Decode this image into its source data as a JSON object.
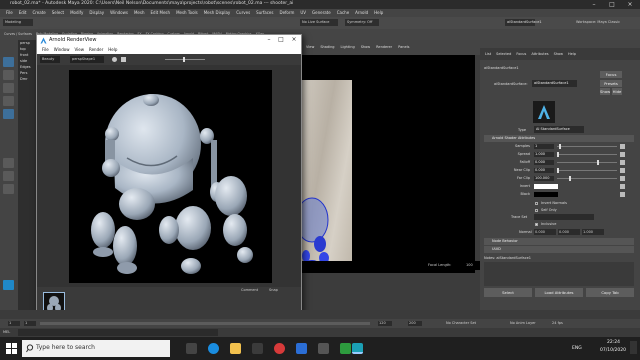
{
  "maya": {
    "title": "robot_02.ma* - Autodesk Maya 2020: C:\\Users\\Neil Nelson\\Documents\\maya\\projects\\robot\\scenes\\robot_02.ma --- shooter_ai",
    "workspace_label": "Workspace: Maya Classic",
    "menus": [
      "File",
      "Edit",
      "Create",
      "Select",
      "Modify",
      "Display",
      "Windows",
      "Mesh",
      "Edit Mesh",
      "Mesh Tools",
      "Mesh Display",
      "Curves",
      "Surfaces",
      "Deform",
      "UV",
      "Generate",
      "Cache",
      "Arnold",
      "Help"
    ],
    "mode_menu": "Modeling",
    "live_surface": "No Live Surface",
    "symmetry": "Symmetry: Off",
    "shelf_tabs": [
      "Curves / Surfaces",
      "Poly Modeling",
      "Sculpting",
      "Rigging",
      "Animation",
      "Rendering",
      "FX",
      "FX Caching",
      "Custom",
      "Arnold",
      "Bifrost",
      "MASH",
      "Motion Graphics",
      "XGen"
    ],
    "outliner_items": [
      "persp",
      "top",
      "front",
      "side",
      "Edges",
      "Pers",
      "Dmr"
    ],
    "viewport": {
      "menus": [
        "View",
        "Shading",
        "Lighting",
        "Show",
        "Renderer",
        "Panels"
      ],
      "focal_length_label": "Focal Length:",
      "focal_length_value": "100"
    },
    "attribute_editor": {
      "tabs": [
        "List",
        "Selected",
        "Focus",
        "Attributes",
        "Show",
        "Help"
      ],
      "node_tab": "aiStandardSurface1",
      "node_label": "aiStandardSurface:",
      "node_value": "aiStandardSurface1",
      "focus_btn": "Focus",
      "presets_btn": "Presets",
      "show_btn": "Show",
      "hide_btn": "Hide",
      "type_label": "Type",
      "type_value": "AI StandardSurface",
      "section_title": "Arnold Shader Attributes",
      "rows": [
        {
          "label": "Samples",
          "value": "1"
        },
        {
          "label": "Spread",
          "value": "1.000"
        },
        {
          "label": "Falloff",
          "value": "0.000"
        },
        {
          "label": "Near Clip",
          "value": "0.000"
        },
        {
          "label": "Far Clip",
          "value": "100.000"
        },
        {
          "label": "Invert",
          "value": ""
        },
        {
          "label": "Black",
          "value": ""
        }
      ],
      "checkbox1": "Invert Normals",
      "checkbox2": "Self Only",
      "trace_set_label": "Trace Set",
      "inclusive_label": "Inclusive",
      "normal_label": "Normal",
      "normal_values": [
        "0.000",
        "0.000",
        "1.000"
      ],
      "collapsed_sections": [
        "Node Behavior",
        "UUID"
      ],
      "notes_label": "Notes: aiStandardSurface1",
      "buttons": [
        "Select",
        "Load Attributes",
        "Copy Tab"
      ]
    },
    "timeline": {
      "start": "1",
      "end": "120",
      "range_end": "200",
      "current": "1",
      "character_set": "No Character Set",
      "anim_layer": "No Anim Layer",
      "fps": "24 fps"
    },
    "cmd_language": "MEL"
  },
  "render_view": {
    "title": "Arnold RenderView",
    "menus": [
      "File",
      "Window",
      "View",
      "Render",
      "Help"
    ],
    "toolbar_camera": "Beauty",
    "toolbar_aov": "perspShape1",
    "status_text": "00:00:11 | 1024x1024 (1:1) | perspShape1 | samples 3/1/1/1/0/0 | 3000.00 MB",
    "tab_comment": "Comment",
    "tab_snapshot": "Snap"
  },
  "taskbar": {
    "search_placeholder": "Type here to search",
    "language": "ENG",
    "time": "22:24",
    "date": "07/10/2020"
  }
}
